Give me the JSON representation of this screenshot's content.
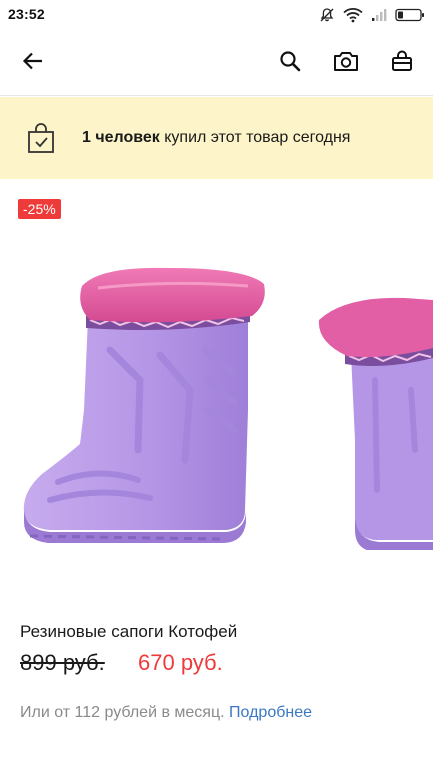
{
  "status_bar": {
    "time": "23:52",
    "icons": [
      "mute-bell-icon",
      "wifi-icon",
      "signal-icon",
      "battery-icon"
    ]
  },
  "toolbar": {
    "icons": [
      "back-arrow-icon",
      "search-icon",
      "camera-icon",
      "shopping-bag-icon"
    ]
  },
  "notice": {
    "count_text": "1 человек",
    "rest_text": " купил этот товар сегодня",
    "icon": "bag-check-icon",
    "background": "#fdf5c9"
  },
  "product": {
    "discount_badge": "-25%",
    "title": "Резиновые сапоги Котофей",
    "old_price": "899 руб.",
    "new_price": "670 руб.",
    "installment_text": "Или от 112 рублей в месяц.",
    "installment_link": "Подробнее"
  },
  "colors": {
    "accent_red": "#ef3a3a",
    "link_blue": "#3a78c2",
    "boot_lilac": "#b99be6",
    "cuff_pink": "#e05aa0"
  }
}
